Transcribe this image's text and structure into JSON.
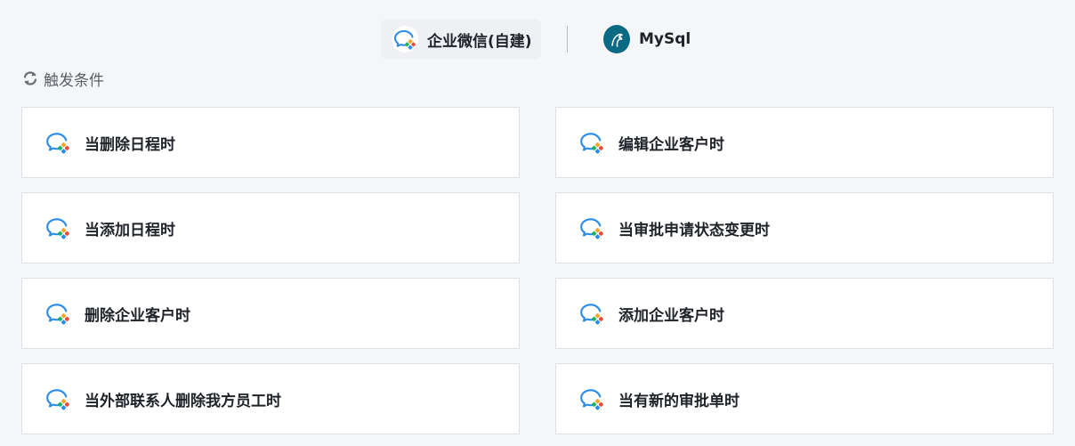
{
  "app_tabs": [
    {
      "label": "企业微信(自建)",
      "icon": "wecom-icon",
      "active": true
    },
    {
      "label": "MySql",
      "icon": "mysql-dolphin-icon",
      "active": false
    }
  ],
  "section": {
    "title": "触发条件",
    "icon": "refresh-icon"
  },
  "triggers": [
    {
      "label": "当删除日程时",
      "icon": "wecom-icon"
    },
    {
      "label": "编辑企业客户时",
      "icon": "wecom-icon"
    },
    {
      "label": "当添加日程时",
      "icon": "wecom-icon"
    },
    {
      "label": "当审批申请状态变更时",
      "icon": "wecom-icon"
    },
    {
      "label": "删除企业客户时",
      "icon": "wecom-icon"
    },
    {
      "label": "添加企业客户时",
      "icon": "wecom-icon"
    },
    {
      "label": "当外部联系人删除我方员工时",
      "icon": "wecom-icon"
    },
    {
      "label": "当有新的审批单时",
      "icon": "wecom-icon"
    }
  ],
  "colors": {
    "background": "#f5f6f8",
    "card_border": "#dcdfe5",
    "mysql_brand": "#0b6a83",
    "wecom_blue": "#2a8ce8"
  }
}
